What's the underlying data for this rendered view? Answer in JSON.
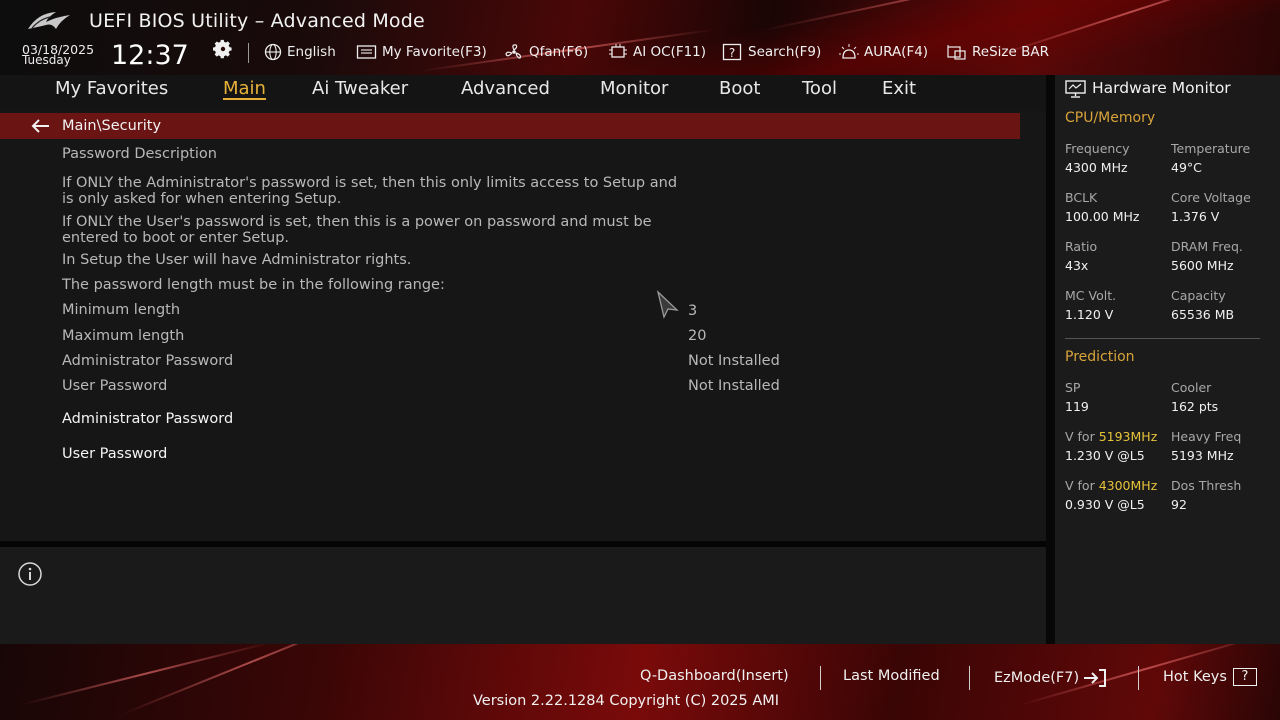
{
  "header": {
    "title": "UEFI BIOS Utility – Advanced Mode",
    "date": "03/18/2025",
    "weekday": "Tuesday",
    "time": "12:37",
    "logo_icon": "rog-logo-icon",
    "settings_icon": "gear-icon"
  },
  "toolbar": {
    "language": "English",
    "my_favorite": "My Favorite(F3)",
    "qfan": "Qfan(F6)",
    "ai_oc": "AI OC(F11)",
    "search": "Search(F9)",
    "aura": "AURA(F4)",
    "resize_bar": "ReSize BAR"
  },
  "menu": {
    "items": [
      {
        "label": "My Favorites"
      },
      {
        "label": "Main",
        "active": true
      },
      {
        "label": "Ai Tweaker"
      },
      {
        "label": "Advanced"
      },
      {
        "label": "Monitor"
      },
      {
        "label": "Boot"
      },
      {
        "label": "Tool"
      },
      {
        "label": "Exit"
      }
    ]
  },
  "main": {
    "breadcrumb": "Main\\Security",
    "description_title": "Password Description",
    "desc1_line1": "If ONLY the Administrator's password is set, then this only limits access to Setup and",
    "desc1_line2": "is only asked for when entering Setup.",
    "desc2_line1": "If ONLY the User's password is set, then this is a power on password and must be",
    "desc2_line2": "entered to boot or enter Setup.",
    "desc3": "In Setup the User will have Administrator rights.",
    "desc4": "The password length must be in the following range:",
    "rows": [
      {
        "label": "Minimum length",
        "value": "3"
      },
      {
        "label": "Maximum length",
        "value": "20"
      },
      {
        "label": "Administrator Password",
        "value": "Not Installed"
      },
      {
        "label": "User Password",
        "value": "Not Installed"
      }
    ],
    "links": [
      {
        "label": "Administrator Password"
      },
      {
        "label": "User Password"
      }
    ]
  },
  "hardware_monitor": {
    "title": "Hardware Monitor",
    "cpu_memory": {
      "heading": "CPU/Memory",
      "frequency_label": "Frequency",
      "frequency": "4300 MHz",
      "temperature_label": "Temperature",
      "temperature": "49°C",
      "bclk_label": "BCLK",
      "bclk": "100.00 MHz",
      "core_voltage_label": "Core Voltage",
      "core_voltage": "1.376 V",
      "ratio_label": "Ratio",
      "ratio": "43x",
      "dram_freq_label": "DRAM Freq.",
      "dram_freq": "5600 MHz",
      "mc_volt_label": "MC Volt.",
      "mc_volt": "1.120 V",
      "capacity_label": "Capacity",
      "capacity": "65536 MB"
    },
    "prediction": {
      "heading": "Prediction",
      "sp_label": "SP",
      "sp": "119",
      "cooler_label": "Cooler",
      "cooler": "162 pts",
      "v_for_prefix": "V for",
      "v_for_1_freq": "5193MHz",
      "v_for_1_value": "1.230 V @L5",
      "heavy_freq_label": "Heavy Freq",
      "heavy_freq": "5193 MHz",
      "v_for_2_freq": "4300MHz",
      "v_for_2_value": "0.930 V @L5",
      "dos_thresh_label": "Dos Thresh",
      "dos_thresh": "92"
    }
  },
  "footer": {
    "q_dashboard": "Q-Dashboard(Insert)",
    "last_modified": "Last Modified",
    "ezmode": "EzMode(F7)",
    "hot_keys": "Hot Keys",
    "hot_keys_key": "?",
    "version": "Version 2.22.1284 Copyright (C) 2025 AMI"
  },
  "colors": {
    "accent": "#e8b23a",
    "breadcrumb_bg": "#6b1414",
    "banner_red": "#7a0a0a"
  }
}
